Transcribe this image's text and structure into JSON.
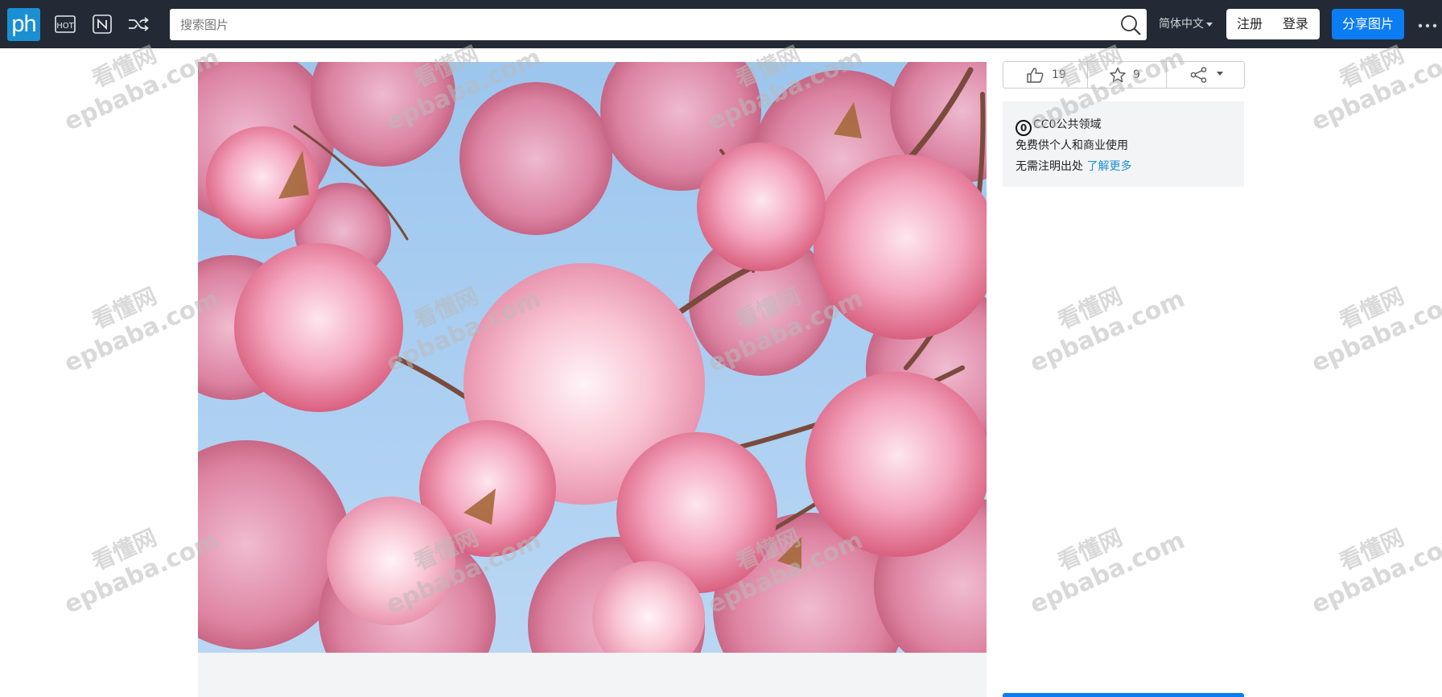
{
  "header": {
    "logo_text": "ph",
    "nav_icons": [
      "hot-icon",
      "new-icon",
      "shuffle-icon"
    ],
    "search": {
      "placeholder": "搜索图片",
      "value": ""
    },
    "language": "简体中文",
    "register_label": "注册",
    "login_label": "登录",
    "share_label": "分享图片",
    "colors": {
      "bar": "#232a35",
      "logo": "#1a8fd1",
      "primary": "#0c7cf2"
    }
  },
  "photo": {
    "subject": "pink-cherry-blossom-photo"
  },
  "sidebar": {
    "likes": "19",
    "favorites": "9",
    "license": {
      "title": "CC0公共领域",
      "line1": "免费供个人和商业使用",
      "line2": "无需注明出处",
      "learn_more": "了解更多"
    }
  },
  "watermark": {
    "line1": "看懂网",
    "line2": "epbaba.com"
  }
}
